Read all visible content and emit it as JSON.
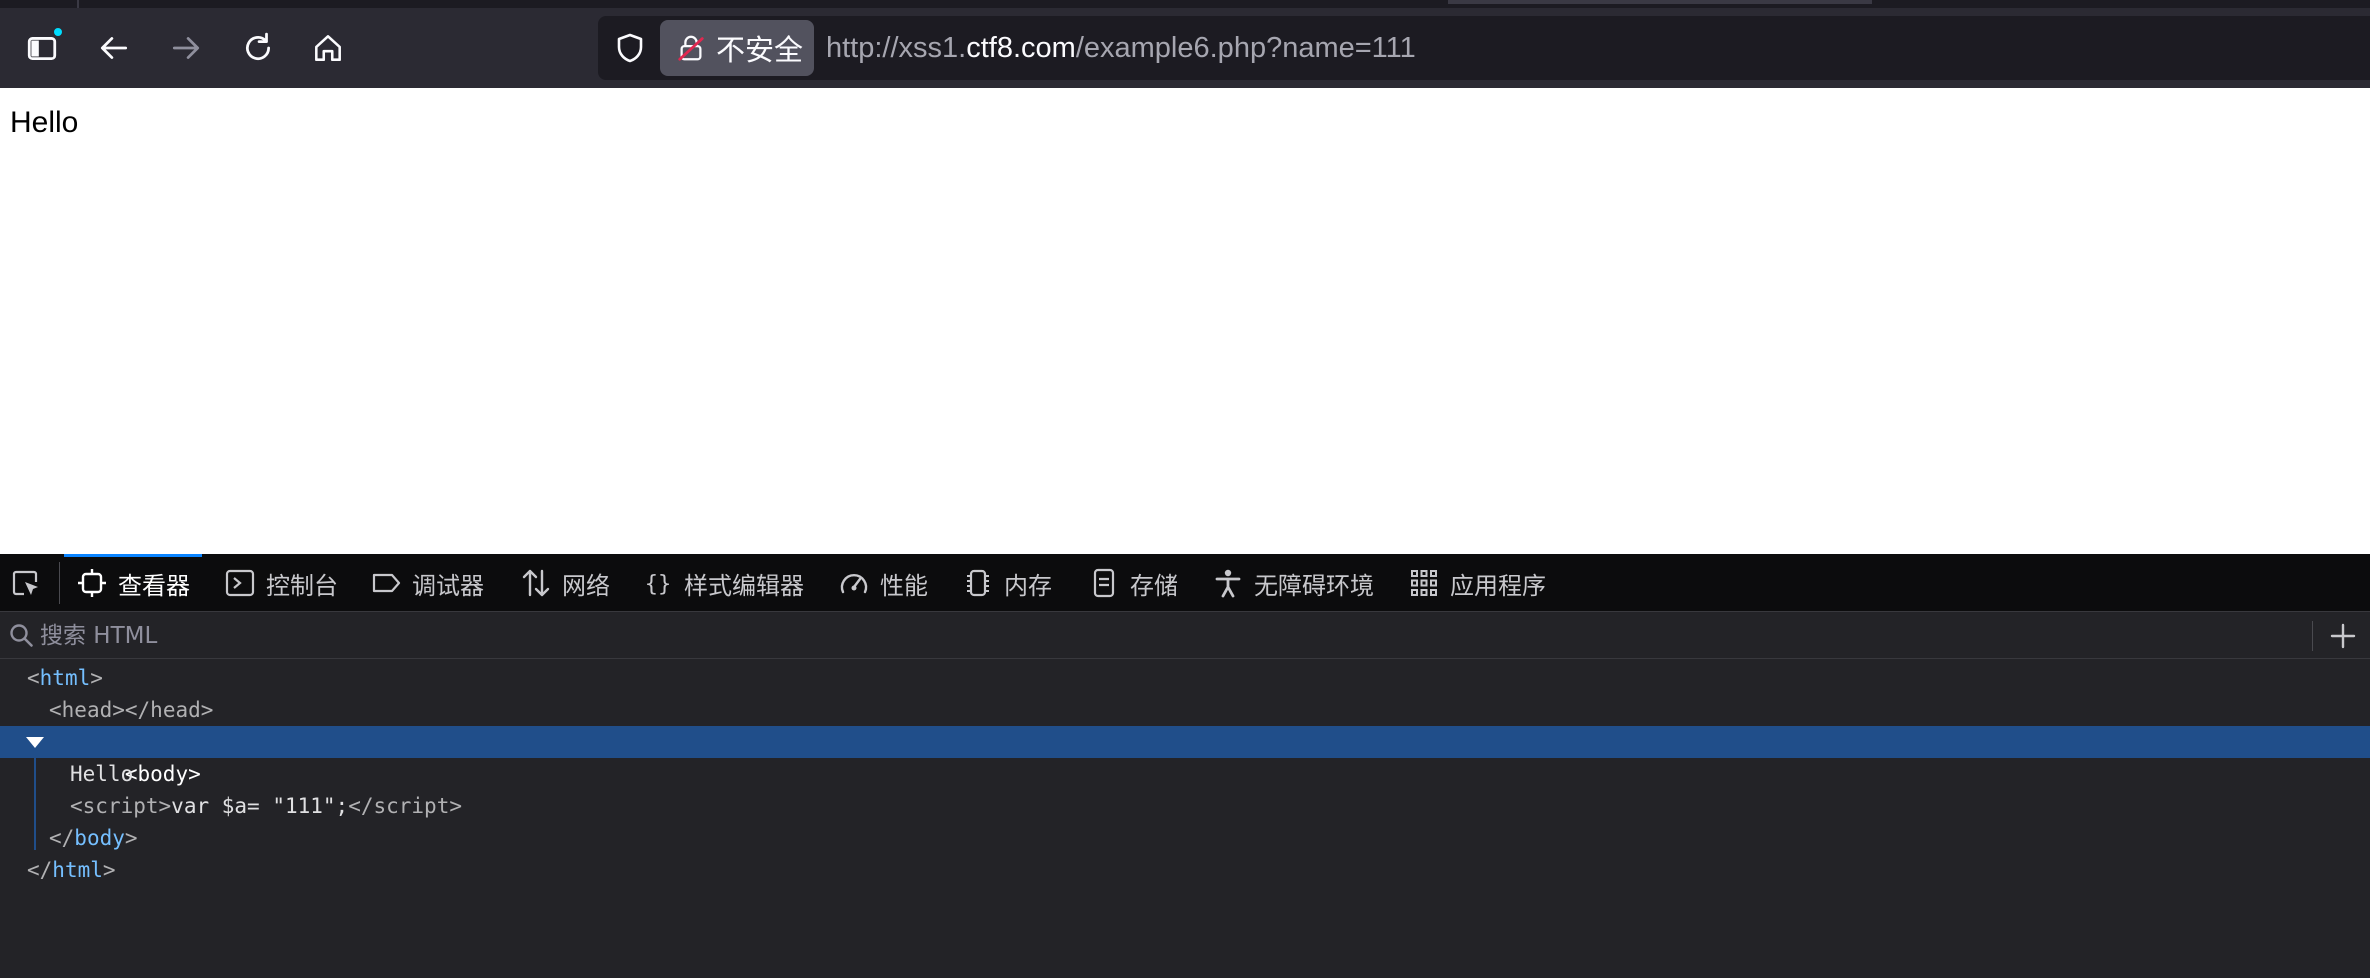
{
  "browser": {
    "url_scheme": "http://xss1.",
    "url_host": "ctf8.com",
    "url_rest": "/example6.php?name=111",
    "security_label": "不安全",
    "icons": [
      "sidebar-icon",
      "back-icon",
      "forward-icon",
      "reload-icon",
      "home-icon",
      "shield-icon",
      "insecure-lock-icon"
    ]
  },
  "page": {
    "body_text": "Hello"
  },
  "devtools": {
    "tabs": [
      {
        "label": "查看器",
        "icon": "inspector-icon",
        "active": true
      },
      {
        "label": "控制台",
        "icon": "console-icon"
      },
      {
        "label": "调试器",
        "icon": "debugger-icon"
      },
      {
        "label": "网络",
        "icon": "network-icon"
      },
      {
        "label": "样式编辑器",
        "icon": "style-editor-icon"
      },
      {
        "label": "性能",
        "icon": "performance-icon"
      },
      {
        "label": "内存",
        "icon": "memory-icon"
      },
      {
        "label": "存储",
        "icon": "storage-icon"
      },
      {
        "label": "无障碍环境",
        "icon": "accessibility-icon"
      },
      {
        "label": "应用程序",
        "icon": "application-icon"
      }
    ],
    "search_placeholder": "搜索 HTML",
    "markup": {
      "html_tag": "html",
      "head_tag": "head",
      "body_tag": "body",
      "text_node": "Hello",
      "script_tag": "script",
      "script_content": "var $a= \"111\";"
    }
  },
  "colors": {
    "toolbar_bg": "#2b2a33",
    "urlbar_bg": "#1c1b22",
    "devtools_bg": "#232327",
    "selection": "#204e8a",
    "accent": "#0a84ff",
    "tag_blue": "#75bfff"
  }
}
